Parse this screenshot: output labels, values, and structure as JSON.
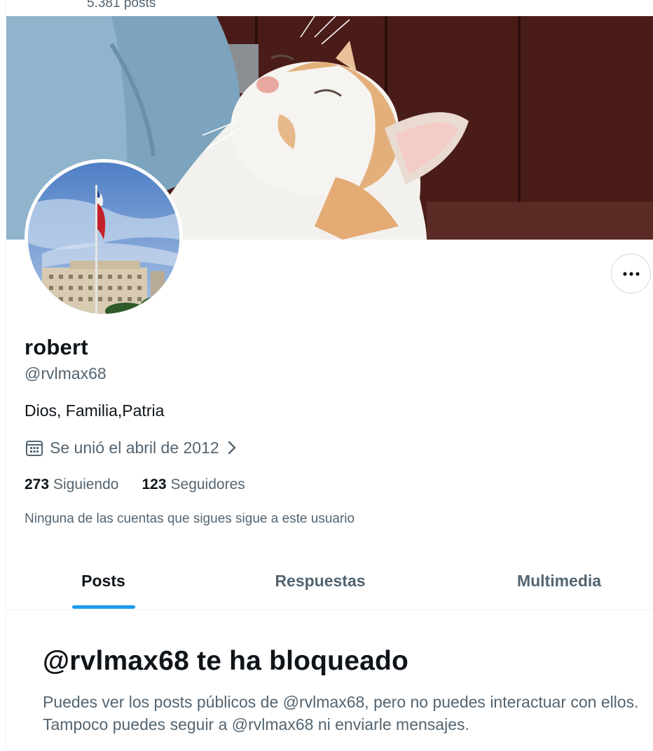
{
  "header": {
    "post_count": "5.381 posts"
  },
  "profile": {
    "display_name": "robert",
    "handle": "@rvlmax68",
    "bio": "Dios, Familia,Patria",
    "joined": "Se unió el abril de 2012",
    "following_count": "273",
    "following_label": "Siguiendo",
    "followers_count": "123",
    "followers_label": "Seguidores",
    "mutual_note": "Ninguna de las cuentas que sigues sigue a este usuario"
  },
  "icons": {
    "more": "more-dots-icon",
    "calendar": "calendar-icon",
    "chevron": "chevron-right-icon"
  },
  "tabs": [
    {
      "label": "Posts",
      "active": true
    },
    {
      "label": "Respuestas",
      "active": false
    },
    {
      "label": "Multimedia",
      "active": false
    }
  ],
  "blocked": {
    "title": "@rvlmax68 te ha bloqueado",
    "description": "Puedes ver los posts públicos de @rvlmax68, pero no puedes interactuar con ellos. Tampoco puedes seguir a @rvlmax68 ni enviarle mensajes."
  },
  "colors": {
    "accent": "#1d9bf0",
    "text_primary": "#0f1419",
    "text_secondary": "#536471",
    "border": "#eff3f4"
  }
}
